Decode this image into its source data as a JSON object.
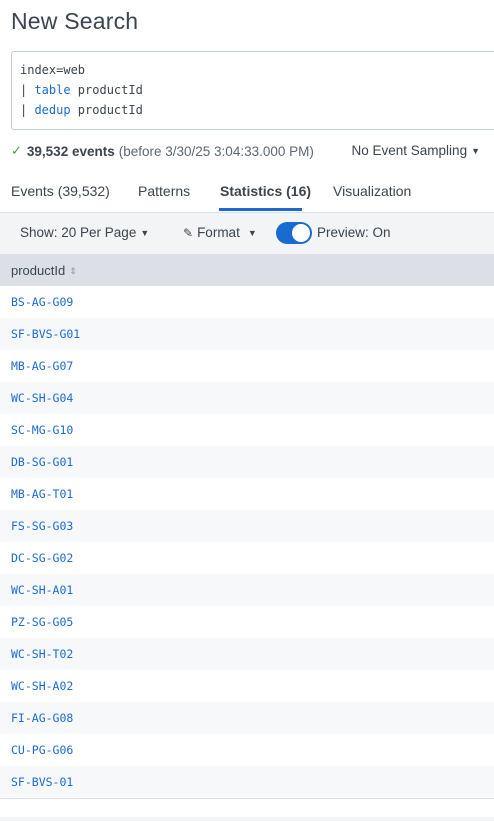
{
  "page": {
    "title": "New Search"
  },
  "query": {
    "line1": "index=web",
    "line2_pipe": "| ",
    "line2_cmd": "table",
    "line2_arg": " productId",
    "line3_pipe": "| ",
    "line3_cmd": "dedup",
    "line3_arg": " productId"
  },
  "status": {
    "events_count": "39,532 events",
    "before_text": "(before 3/30/25 3:04:33.000 PM)",
    "sampling": "No Event Sampling"
  },
  "tabs": [
    {
      "label": "Events (39,532)"
    },
    {
      "label": "Patterns"
    },
    {
      "label": "Statistics (16)",
      "active": true
    },
    {
      "label": "Visualization"
    }
  ],
  "controls": {
    "show_per_page": "Show: 20 Per Page",
    "format": "Format",
    "preview": "Preview: On",
    "preview_on": true
  },
  "table": {
    "column": "productId",
    "rows": [
      "BS-AG-G09",
      "SF-BVS-G01",
      "MB-AG-G07",
      "WC-SH-G04",
      "SC-MG-G10",
      "DB-SG-G01",
      "MB-AG-T01",
      "FS-SG-G03",
      "DC-SG-G02",
      "WC-SH-A01",
      "PZ-SG-G05",
      "WC-SH-T02",
      "WC-SH-A02",
      "FI-AG-G08",
      "CU-PG-G06",
      "SF-BVS-01"
    ]
  },
  "colors": {
    "accent": "#1a6bd1",
    "success": "#3e9a3e"
  }
}
